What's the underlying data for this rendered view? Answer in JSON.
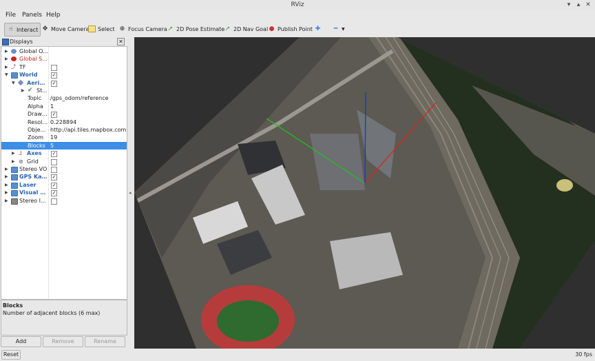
{
  "window": {
    "title": "RViz"
  },
  "menu": [
    "File",
    "Panels",
    "Help"
  ],
  "toolbar": {
    "interact": "Interact",
    "move_camera": "Move Camera",
    "select": "Select",
    "focus_camera": "Focus Camera",
    "pose_estimate": "2D Pose Estimate",
    "nav_goal": "2D Nav Goal",
    "publish_point": "Publish Point"
  },
  "displays_panel": {
    "title": "Displays",
    "rows": [
      {
        "name": "Global O...",
        "value": ""
      },
      {
        "name": "Global St...",
        "value": ""
      },
      {
        "name": "TF",
        "value": ""
      },
      {
        "name": "World",
        "value": ""
      },
      {
        "name": "Aeria...",
        "value": ""
      },
      {
        "name": "St...",
        "value": ""
      },
      {
        "name": "Topic",
        "value": "/gps_odom/reference"
      },
      {
        "name": "Alpha",
        "value": "1"
      },
      {
        "name": "Draw ...",
        "value": ""
      },
      {
        "name": "Resol...",
        "value": "0.228894"
      },
      {
        "name": "Objec...",
        "value": "http://api.tiles.mapbox.com..."
      },
      {
        "name": "Zoom",
        "value": "19"
      },
      {
        "name": "Blocks",
        "value": "5"
      },
      {
        "name": "Axes",
        "value": ""
      },
      {
        "name": "Grid",
        "value": ""
      },
      {
        "name": "Stereo VO",
        "value": ""
      },
      {
        "name": "GPS Kal...",
        "value": ""
      },
      {
        "name": "Laser",
        "value": ""
      },
      {
        "name": "Visual O...",
        "value": ""
      },
      {
        "name": "Stereo I...",
        "value": ""
      }
    ]
  },
  "description": {
    "heading": "Blocks",
    "body": "Number of adjacent blocks (6 max)"
  },
  "buttons": {
    "add": "Add",
    "remove": "Remove",
    "rename": "Rename"
  },
  "status": {
    "reset": "Reset",
    "fps": "30 fps"
  },
  "colors": {
    "selection": "#3d8ee6",
    "x_axis": "#e02020",
    "y_axis": "#20c020",
    "z_axis": "#2030e0"
  }
}
